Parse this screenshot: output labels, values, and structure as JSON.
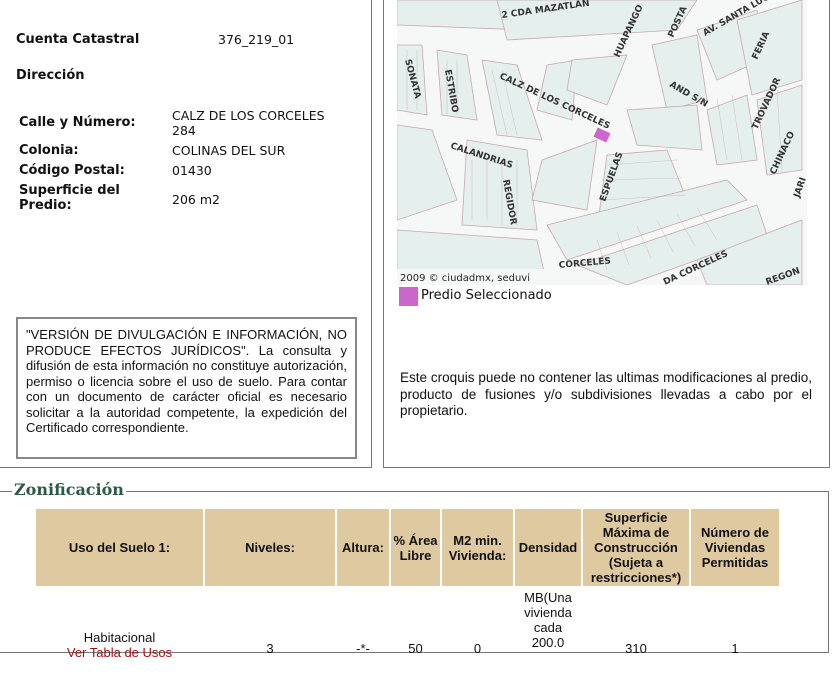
{
  "cuenta": {
    "label": "Cuenta Catastral",
    "value": "376_219_01"
  },
  "direccion": {
    "heading": "Dirección",
    "fields": [
      {
        "label": "Calle y Número:",
        "value": "CALZ DE LOS CORCELES 284"
      },
      {
        "label": "Colonia:",
        "value": "COLINAS DEL SUR"
      },
      {
        "label": "Código Postal:",
        "value": "01430"
      },
      {
        "label": "Superficie del Predio:",
        "value": "206 m2"
      }
    ]
  },
  "disclaimer": "\"VERSIÓN DE DIVULGACIÓN E INFORMACIÓN, NO PRODUCE EFECTOS JURÍDICOS\". La consulta y difusión de esta información no constituye autorización, permiso o licencia sobre el uso de suelo. Para contar con un documento de carácter oficial es necesario solicitar a la autoridad competente, la expedición del Certificado correspondiente.",
  "map": {
    "copyright": "2009 © ciudadmx, seduvi",
    "streets": [
      "2 CDA MAZATLAN",
      "HUAPANGO",
      "POSTA",
      "AV. SANTA LUCIA",
      "FERIA",
      "SONATA",
      "ESTRIBO",
      "CALZ DE LOS CORCELES",
      "AND S/N",
      "TROVADOR",
      "CHINACO",
      "CALANDRIAS",
      "REGIDOR",
      "ESPUELAS",
      "JARI",
      "CORCELES",
      "DA CORCELES",
      "REGON"
    ],
    "selected_color": "#cc66cc"
  },
  "legend": {
    "label": "Predio Seleccionado"
  },
  "croquis_note": "Este croquis puede no contener las ultimas modificaciones al predio, producto de fusiones y/o subdivisiones llevadas a cabo por el propietario.",
  "zonificacion": {
    "title": "Zonificación",
    "headers": [
      "Uso del Suelo 1:",
      "Niveles:",
      "Altura:",
      "% Área Libre",
      "M2 min. Vivienda:",
      "Densidad",
      "Superficie Máxima de Construcción (Sujeta a restricciones*)",
      "Número de Viviendas Permitidas"
    ],
    "row": [
      "Habitacional",
      "3",
      "-*-",
      "50",
      "0",
      "MB(Una vivienda cada 200.0",
      "310",
      "1"
    ],
    "row_link": "Ver Tabla de Usos"
  }
}
